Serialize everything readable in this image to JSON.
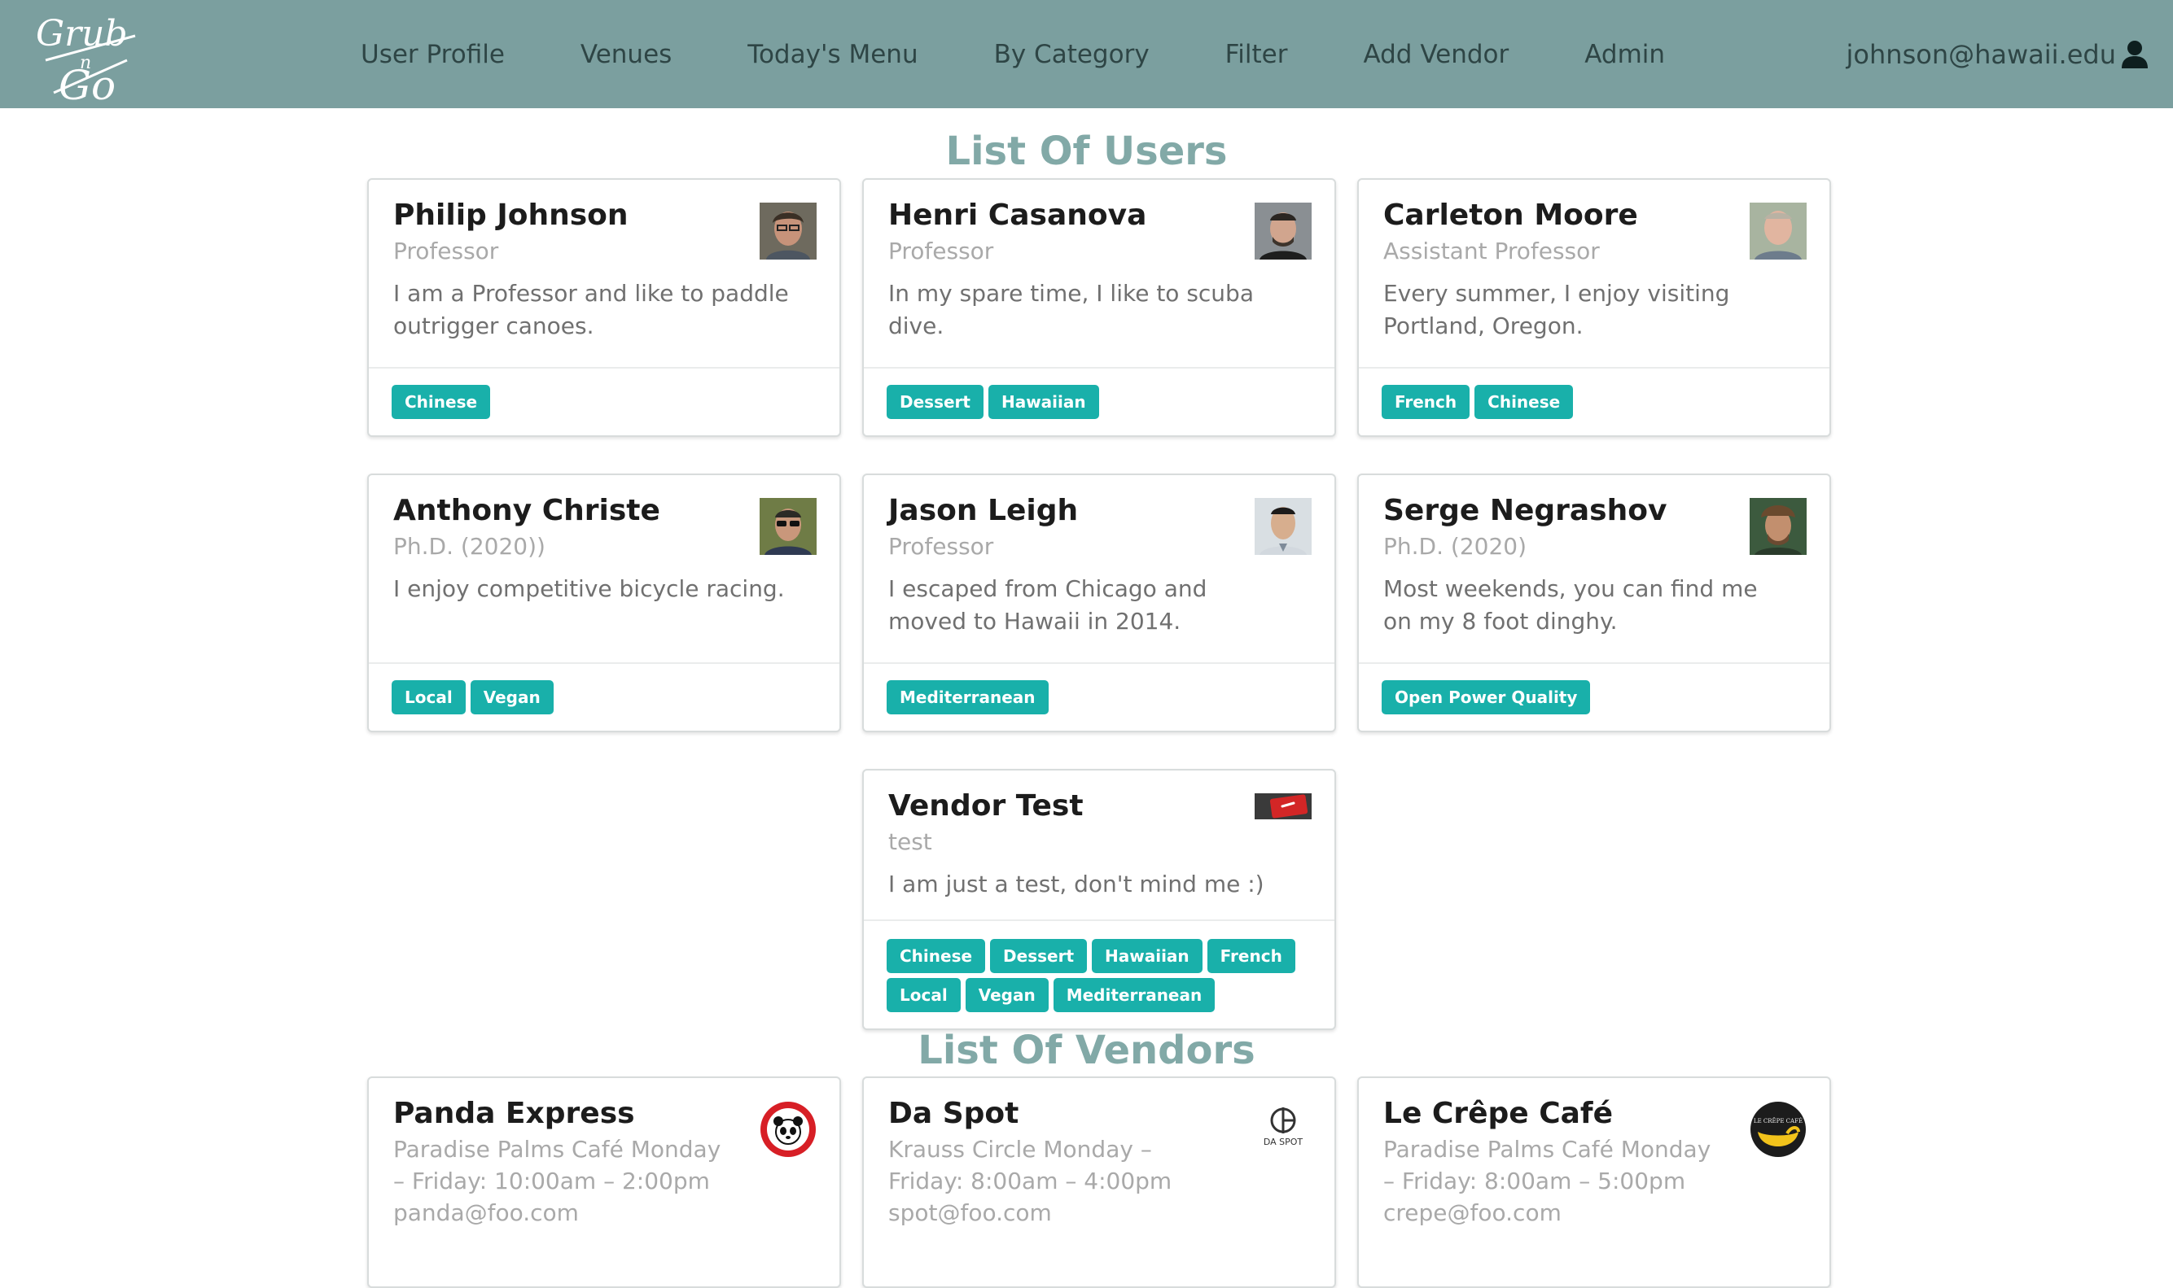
{
  "nav": {
    "logo_text": "Grub n Go",
    "links": [
      "User Profile",
      "Venues",
      "Today's Menu",
      "By Category",
      "Filter",
      "Add Vendor",
      "Admin"
    ],
    "user_email": "johnson@hawaii.edu"
  },
  "headings": {
    "users": "List Of Users",
    "vendors": "List Of Vendors"
  },
  "users": [
    {
      "name": "Philip Johnson",
      "title": "Professor",
      "description": "I am a Professor and like to paddle outrigger canoes.",
      "tags": [
        "Chinese"
      ]
    },
    {
      "name": "Henri Casanova",
      "title": "Professor",
      "description": "In my spare time, I like to scuba dive.",
      "tags": [
        "Dessert",
        "Hawaiian"
      ]
    },
    {
      "name": "Carleton Moore",
      "title": "Assistant Professor",
      "description": "Every summer, I enjoy visiting Portland, Oregon.",
      "tags": [
        "French",
        "Chinese"
      ]
    },
    {
      "name": "Anthony Christe",
      "title": "Ph.D. (2020))",
      "description": "I enjoy competitive bicycle racing.",
      "tags": [
        "Local",
        "Vegan"
      ]
    },
    {
      "name": "Jason Leigh",
      "title": "Professor",
      "description": "I escaped from Chicago and moved to Hawaii in 2014.",
      "tags": [
        "Mediterranean"
      ]
    },
    {
      "name": "Serge Negrashov",
      "title": "Ph.D. (2020)",
      "description": "Most weekends, you can find me on my 8 foot dinghy.",
      "tags": [
        "Open Power Quality"
      ]
    },
    {
      "name": "Vendor Test",
      "title": "test",
      "description": "I am just a test, don't mind me :)",
      "tags": [
        "Chinese",
        "Dessert",
        "Hawaiian",
        "French",
        "Local",
        "Vegan",
        "Mediterranean"
      ]
    }
  ],
  "vendors": [
    {
      "name": "Panda Express",
      "info": "Paradise Palms Café Monday – Friday: 10:00am – 2:00pm panda@foo.com",
      "logo": "panda-express-logo"
    },
    {
      "name": "Da Spot",
      "info": "Krauss Circle Monday – Friday: 8:00am – 4:00pm spot@foo.com",
      "logo_text": "DA SPOT"
    },
    {
      "name": "Le Crêpe Café",
      "info": "Paradise Palms Café Monday – Friday: 8:00am – 5:00pm crepe@foo.com",
      "logo": "le-crepe-cafe-logo"
    }
  ]
}
